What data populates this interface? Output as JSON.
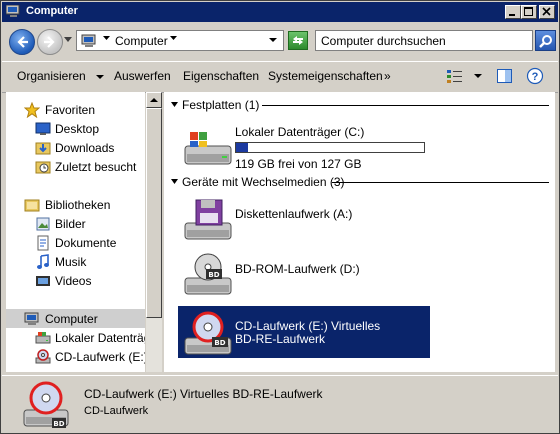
{
  "window": {
    "title": "Computer"
  },
  "address": {
    "breadcrumb": "Computer",
    "search_placeholder": "Computer durchsuchen"
  },
  "commands": {
    "organize": "Organisieren",
    "eject": "Auswerfen",
    "properties": "Eigenschaften",
    "system_properties": "Systemeigenschaften",
    "more": "»"
  },
  "nav": {
    "favorites": "Favoriten",
    "desktop": "Desktop",
    "downloads": "Downloads",
    "recent": "Zuletzt besucht",
    "libraries": "Bibliotheken",
    "pictures": "Bilder",
    "documents": "Dokumente",
    "music": "Musik",
    "videos": "Videos",
    "computer": "Computer",
    "local_disk": "Lokaler Datenträger",
    "cd_drive": "CD-Laufwerk (E:) V"
  },
  "groups": {
    "hard_disks": "Festplatten (1)",
    "removable": "Geräte mit Wechselmedien (3)"
  },
  "drives": {
    "local": {
      "name": "Lokaler Datenträger (C:)",
      "free": "119 GB frei von 127 GB",
      "used_fraction": 0.063
    },
    "floppy": {
      "name": "Diskettenlaufwerk (A:)"
    },
    "bdrom": {
      "name": "BD-ROM-Laufwerk (D:)"
    },
    "cd": {
      "name_line1": "CD-Laufwerk (E:) Virtuelles",
      "name_line2": "BD-RE-Laufwerk"
    }
  },
  "details": {
    "title": "CD-Laufwerk (E:) Virtuelles BD-RE-Laufwerk",
    "type": "CD-Laufwerk"
  },
  "colors": {
    "titlebar": "#0a246a",
    "selection": "#0a246a",
    "capacity_fill": "#1c3aa0"
  }
}
